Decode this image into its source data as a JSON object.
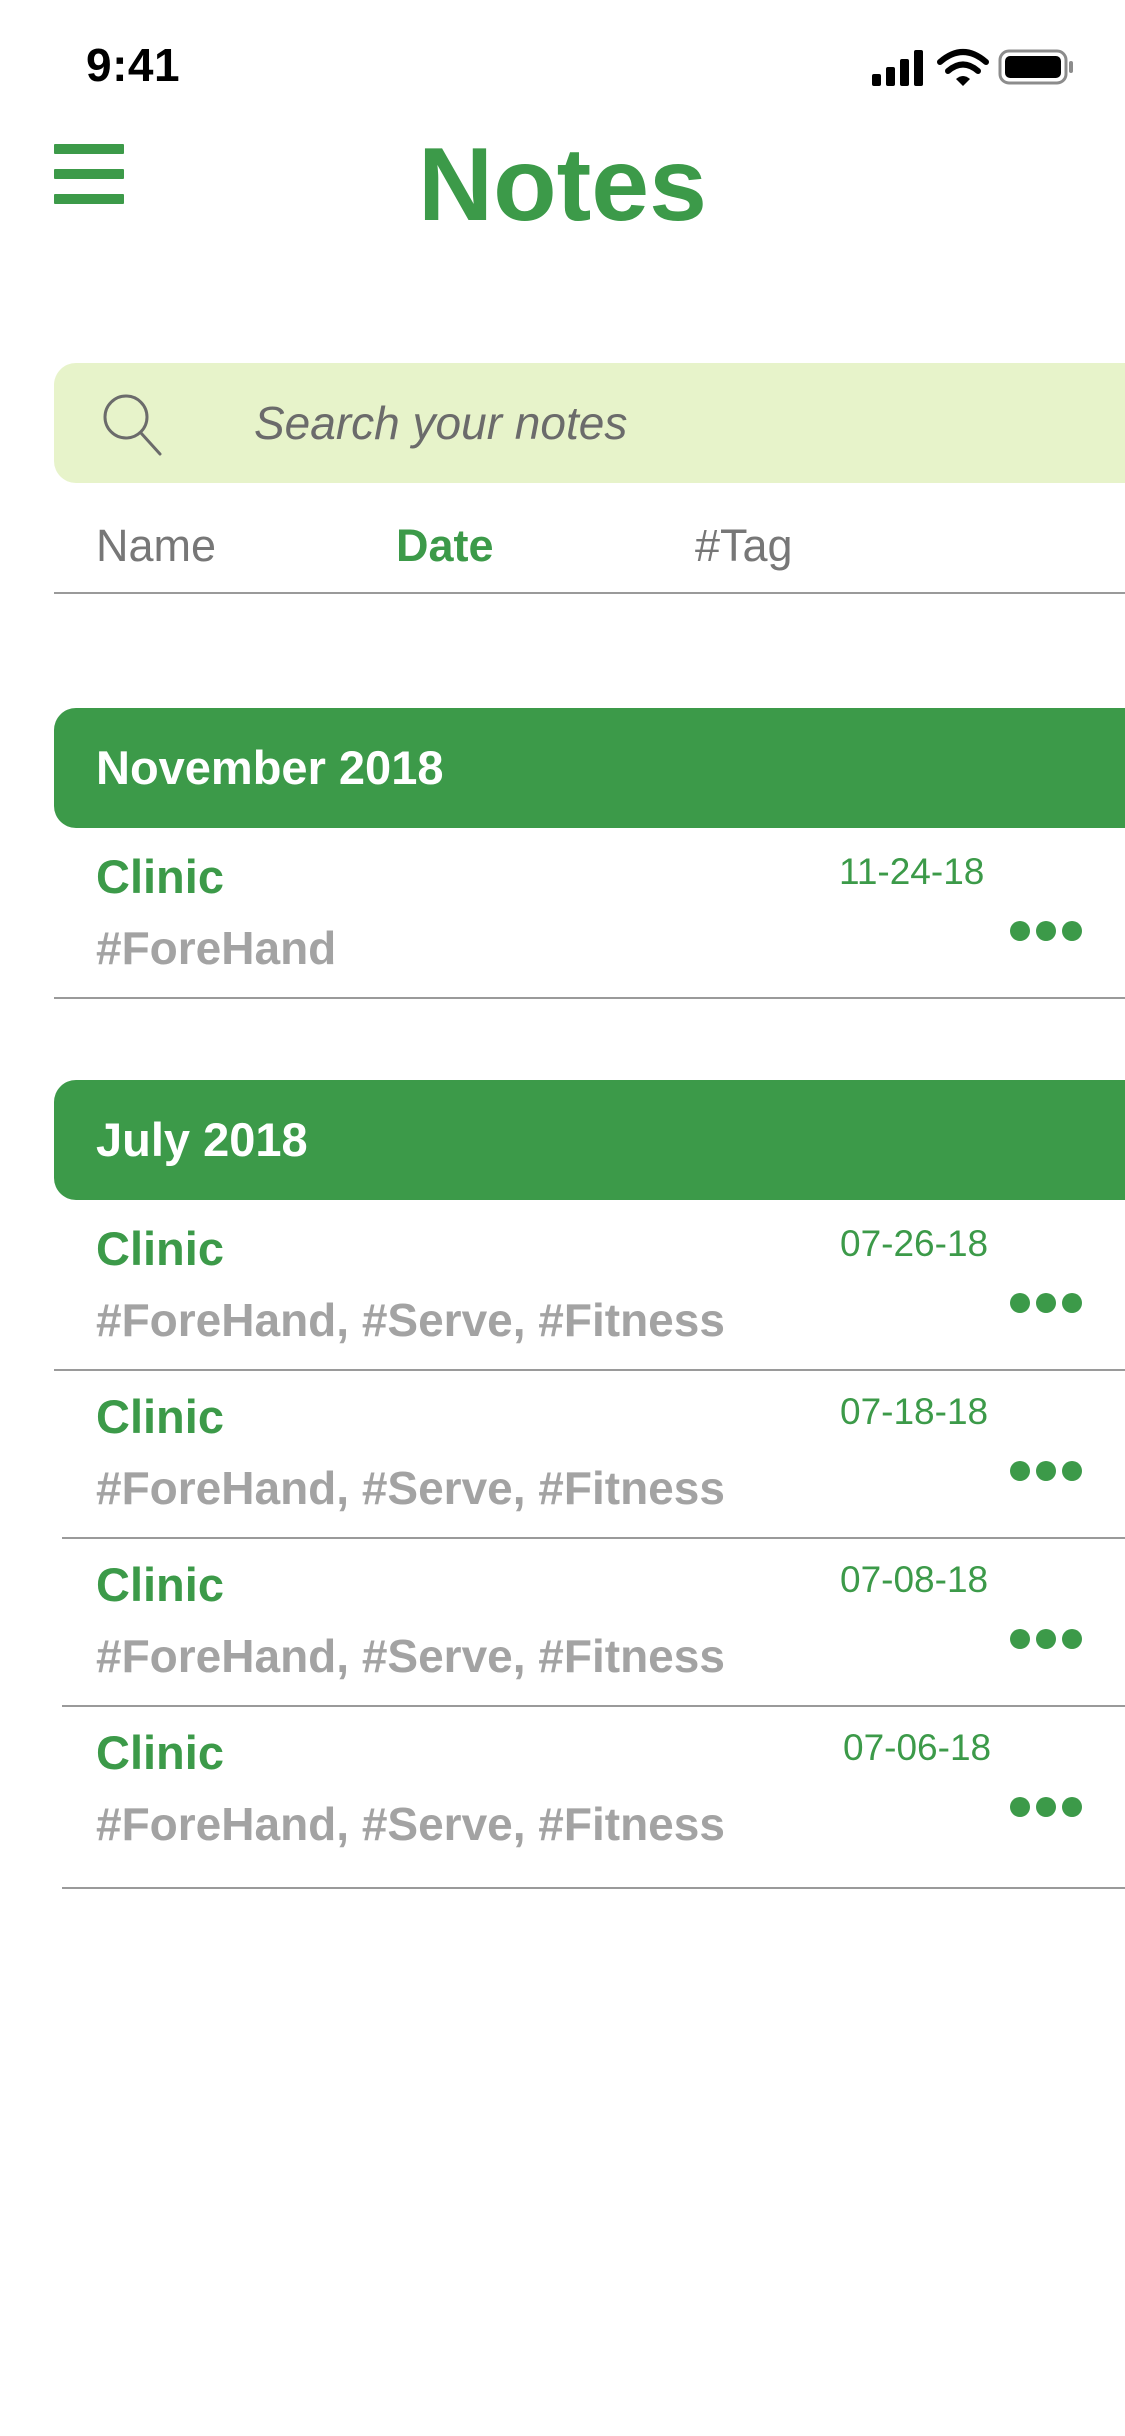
{
  "status_bar": {
    "time": "9:41",
    "icons": [
      "cellular-signal-icon",
      "wifi-icon",
      "battery-icon"
    ]
  },
  "header": {
    "title": "Notes",
    "menu_icon": "hamburger-menu-icon"
  },
  "search": {
    "placeholder": "Search your notes",
    "value": "",
    "icon": "search-icon"
  },
  "sort_tabs": [
    {
      "label": "Name",
      "active": false
    },
    {
      "label": "Date",
      "active": true
    },
    {
      "label": "#Tag",
      "active": false
    }
  ],
  "sections": [
    {
      "title": "November 2018",
      "notes": [
        {
          "title": "Clinic",
          "tags": "#ForeHand",
          "date": "11-24-18"
        }
      ]
    },
    {
      "title": "July 2018",
      "notes": [
        {
          "title": "Clinic",
          "tags": "#ForeHand, #Serve, #Fitness",
          "date": "07-26-18"
        },
        {
          "title": "Clinic",
          "tags": "#ForeHand, #Serve, #Fitness",
          "date": "07-18-18"
        },
        {
          "title": "Clinic",
          "tags": "#ForeHand, #Serve, #Fitness",
          "date": "07-08-18"
        },
        {
          "title": "Clinic",
          "tags": "#ForeHand, #Serve, #Fitness",
          "date": "07-06-18"
        }
      ]
    }
  ],
  "colors": {
    "accent": "#3c9a49",
    "search_background": "#e7f3ca",
    "muted_text": "#777777",
    "tag_text": "#a3a3a3",
    "divider": "#9a9a9a"
  }
}
